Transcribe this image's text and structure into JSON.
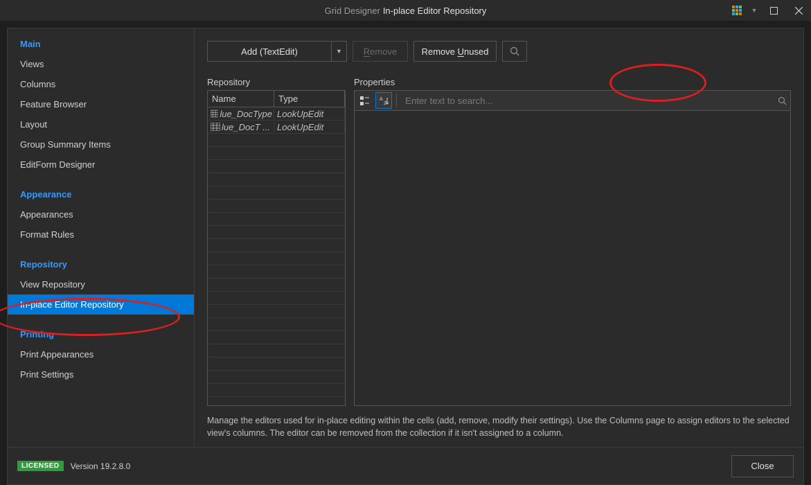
{
  "window": {
    "title_prefix": "Grid Designer",
    "title_main": "In-place Editor Repository"
  },
  "sidebar": {
    "sections": [
      {
        "header": "Main",
        "items": [
          {
            "label": "Views",
            "key": "views"
          },
          {
            "label": "Columns",
            "key": "columns"
          },
          {
            "label": "Feature Browser",
            "key": "feature-browser"
          },
          {
            "label": "Layout",
            "key": "layout"
          },
          {
            "label": "Group Summary Items",
            "key": "group-summary"
          },
          {
            "label": "EditForm Designer",
            "key": "editform"
          }
        ]
      },
      {
        "header": "Appearance",
        "items": [
          {
            "label": "Appearances",
            "key": "appearances"
          },
          {
            "label": "Format Rules",
            "key": "format-rules"
          }
        ]
      },
      {
        "header": "Repository",
        "items": [
          {
            "label": "View Repository",
            "key": "view-repository"
          },
          {
            "label": "In-place Editor Repository",
            "key": "inplace-editor-repo",
            "selected": true
          }
        ]
      },
      {
        "header": "Printing",
        "items": [
          {
            "label": "Print Appearances",
            "key": "print-appearances"
          },
          {
            "label": "Print Settings",
            "key": "print-settings"
          }
        ]
      }
    ]
  },
  "toolbar": {
    "add_label": "Add (TextEdit)",
    "remove_label": "Remove",
    "remove_underline": "R",
    "remove_unused_label": "Remove Unused",
    "remove_unused_underline_index": 7
  },
  "repository": {
    "label": "Repository",
    "columns": {
      "name": "Name",
      "type": "Type"
    },
    "rows": [
      {
        "name": "lue_DocType",
        "type": "LookUpEdit"
      },
      {
        "name": "lue_DocT ...",
        "type": "LookUpEdit"
      }
    ],
    "empty_row_count": 20
  },
  "properties": {
    "label": "Properties",
    "search_placeholder": "Enter text to search..."
  },
  "help_text": "Manage the editors used for in-place editing within the cells (add, remove, modify their settings). Use the Columns page to assign editors to the selected view's columns. The editor can be removed from the collection if it isn't assigned to a column.",
  "footer": {
    "license": "LICENSED",
    "version": "Version 19.2.8.0",
    "close": "Close"
  }
}
